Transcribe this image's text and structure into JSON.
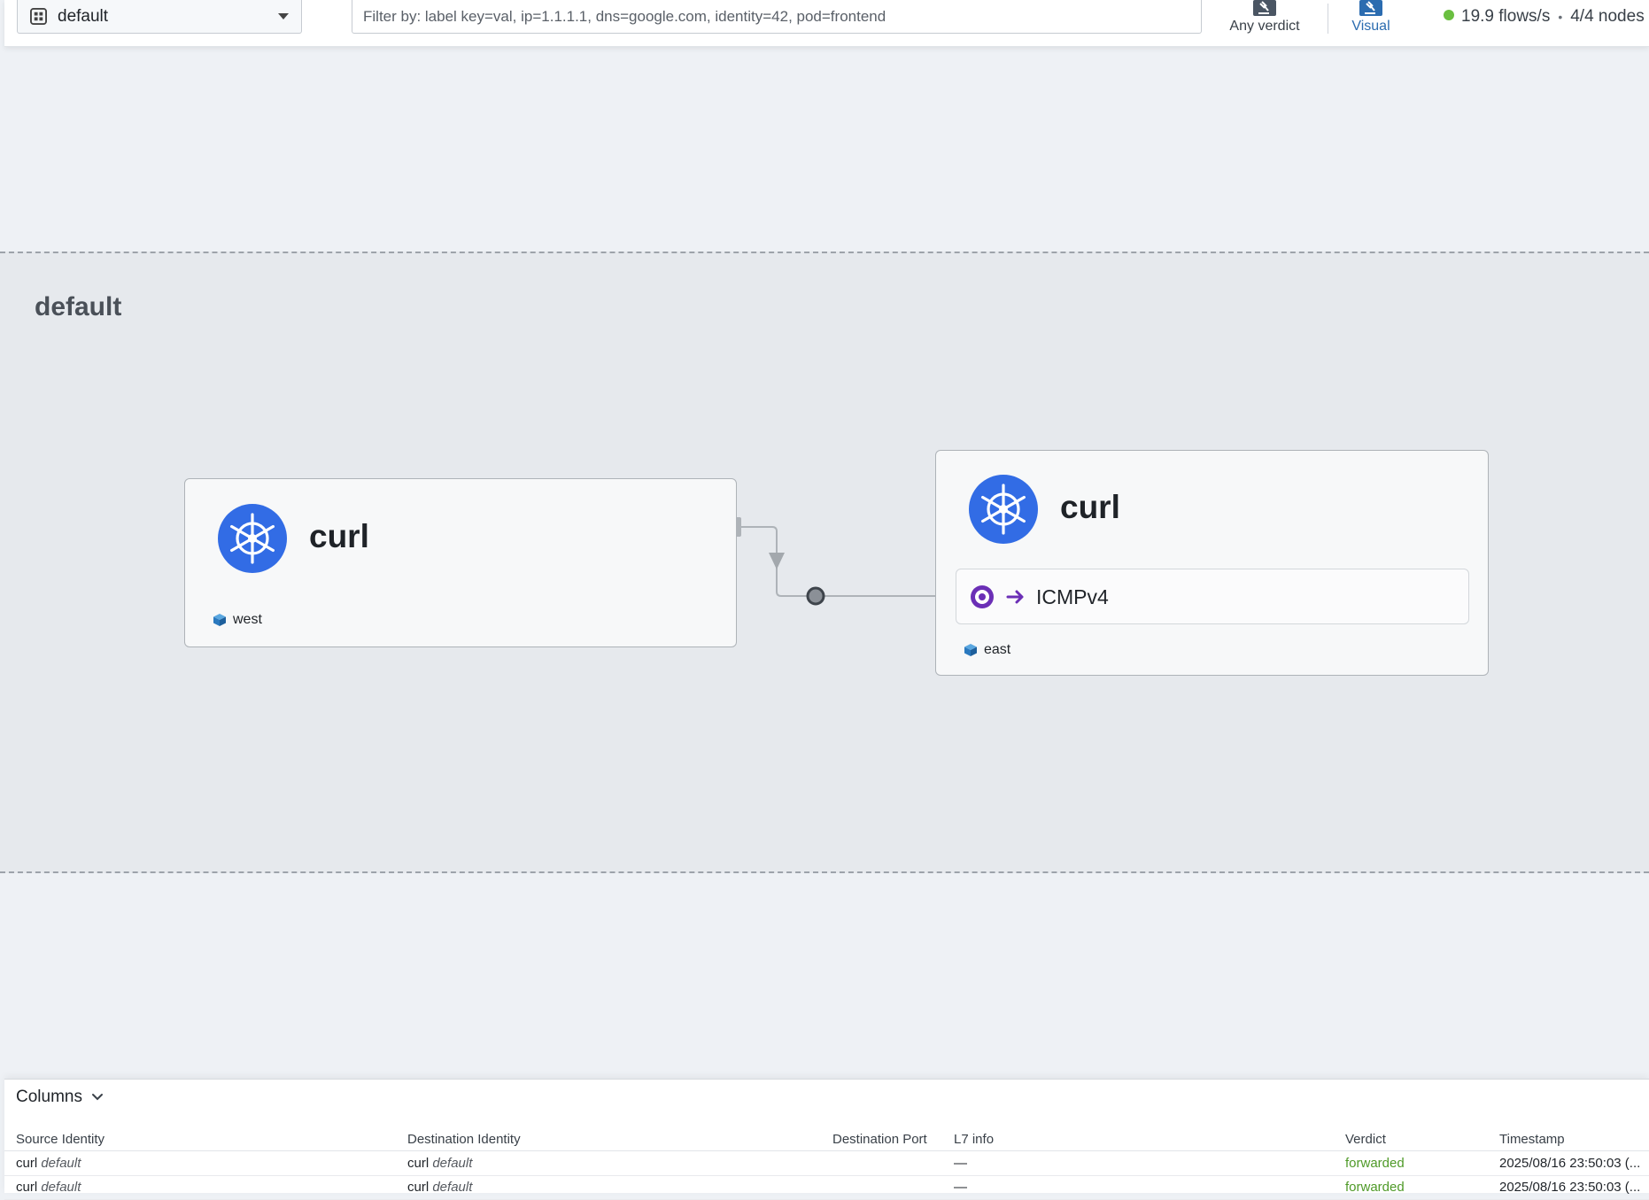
{
  "header": {
    "namespace_selector": {
      "value": "default",
      "icon": "namespace-icon"
    },
    "filter": {
      "placeholder": "Filter by: label key=val, ip=1.1.1.1, dns=google.com, identity=42, pod=frontend",
      "value": ""
    },
    "verdict_button": {
      "label": "Any verdict",
      "icon": "gavel-icon"
    },
    "visual_button": {
      "label": "Visual",
      "icon": "gavel-icon"
    },
    "status": {
      "flows_rate": "19.9 flows/s",
      "separator": "•",
      "nodes": "4/4 nodes"
    },
    "colors": {
      "accent": "#2b6cb0",
      "status_ok": "#6abf40"
    }
  },
  "map": {
    "namespace_label": "default",
    "cards": [
      {
        "title": "curl",
        "icon": "kubernetes-icon",
        "cluster": "west",
        "ports": []
      },
      {
        "title": "curl",
        "icon": "kubernetes-icon",
        "cluster": "east",
        "ports": [
          {
            "protocol": "ICMPv4",
            "direction": "ingress"
          }
        ]
      }
    ],
    "colors": {
      "k8s_blue": "#326ce5",
      "port_purple": "#6b2fb6"
    }
  },
  "flows": {
    "columns_button": "Columns",
    "headers": {
      "source": "Source Identity",
      "destination": "Destination Identity",
      "port": "Destination Port",
      "l7": "L7 info",
      "verdict": "Verdict",
      "timestamp": "Timestamp"
    },
    "rows": [
      {
        "source_name": "curl",
        "source_ns": "default",
        "dest_name": "curl",
        "dest_ns": "default",
        "port": "",
        "l7": "—",
        "verdict": "forwarded",
        "timestamp": "2025/08/16 23:50:03 (..."
      },
      {
        "source_name": "curl",
        "source_ns": "default",
        "dest_name": "curl",
        "dest_ns": "default",
        "port": "",
        "l7": "—",
        "verdict": "forwarded",
        "timestamp": "2025/08/16 23:50:03 (..."
      }
    ],
    "colors": {
      "forwarded": "#4f9a28"
    }
  }
}
